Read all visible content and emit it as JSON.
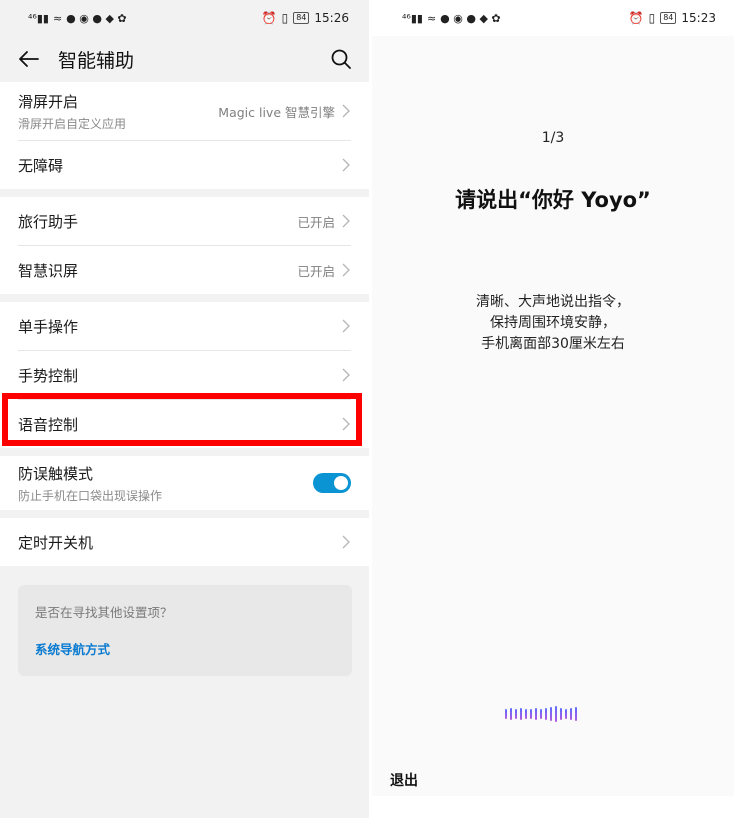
{
  "left_screen": {
    "status": {
      "time": "15:26",
      "battery": "84"
    },
    "title": "智能辅助",
    "groups": [
      [
        {
          "title": "滑屏开启",
          "subtitle": "滑屏开启自定义应用",
          "value": "Magic live 智慧引擎"
        },
        {
          "title": "无障碍",
          "subtitle": "",
          "value": ""
        }
      ],
      [
        {
          "title": "旅行助手",
          "subtitle": "",
          "value": "已开启"
        },
        {
          "title": "智慧识屏",
          "subtitle": "",
          "value": "已开启"
        }
      ],
      [
        {
          "title": "单手操作",
          "subtitle": "",
          "value": ""
        },
        {
          "title": "手势控制",
          "subtitle": "",
          "value": ""
        },
        {
          "title": "语音控制",
          "subtitle": "",
          "value": ""
        }
      ],
      [
        {
          "title": "防误触模式",
          "subtitle": "防止手机在口袋出现误操作",
          "toggle": true
        }
      ],
      [
        {
          "title": "定时开关机",
          "subtitle": "",
          "value": ""
        }
      ]
    ],
    "suggest": {
      "question": "是否在寻找其他设置项？",
      "link": "系统导航方式"
    },
    "colors": {
      "toggle_on": "#0a94d4",
      "highlight": "#ff0000",
      "link": "#0a7bd0"
    }
  },
  "right_screen": {
    "status": {
      "time": "15:23",
      "battery": "84"
    },
    "step": "1/3",
    "prompt": "请说出“你好 Yoyo”",
    "instructions": [
      "清晰、大声地说出指令，",
      "保持周围环境安静，",
      "手机离面部30厘米左右"
    ],
    "exit": "退出"
  }
}
